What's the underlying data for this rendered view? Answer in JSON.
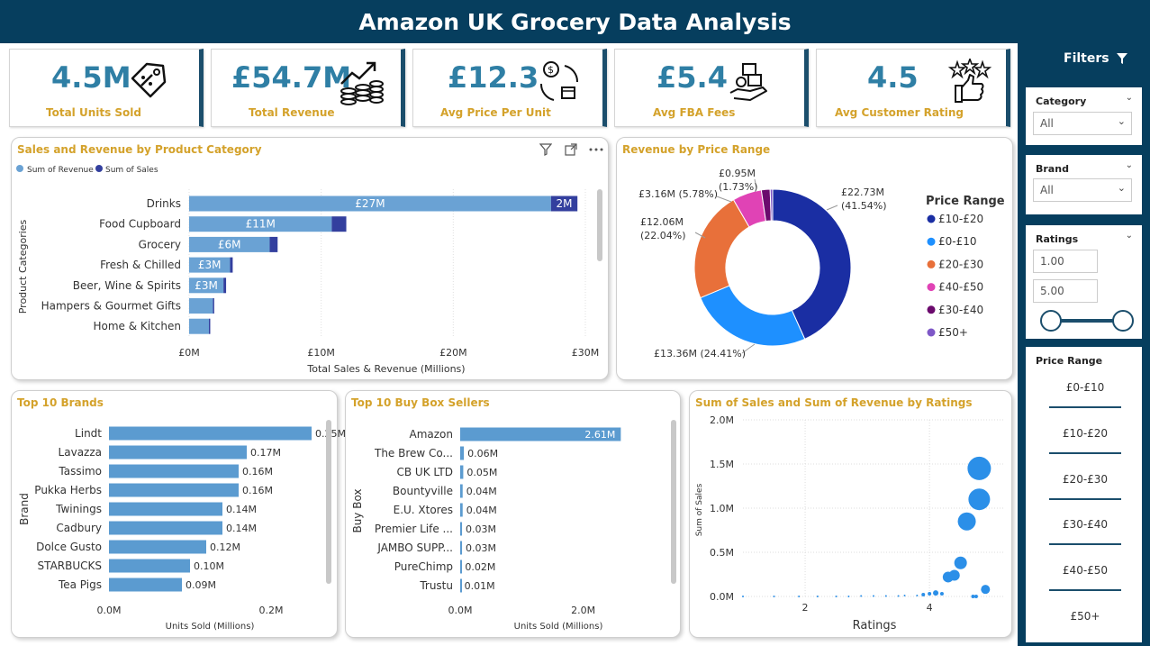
{
  "page_title": "Amazon UK Grocery Data Analysis",
  "kpis": [
    {
      "value": "4.5M",
      "label": "Total Units Sold",
      "icon": "price-tag-icon"
    },
    {
      "value": "£54.7M",
      "label": "Total Revenue",
      "icon": "revenue-growth-icon"
    },
    {
      "value": "£12.3",
      "label": "Avg Price Per Unit",
      "icon": "exchange-cycle-icon"
    },
    {
      "value": "£5.4",
      "label": "Avg FBA Fees",
      "icon": "hand-boxes-icon"
    },
    {
      "value": "4.5",
      "label": "Avg Customer Rating",
      "icon": "thumbs-up-stars-icon"
    }
  ],
  "colors": {
    "header": "#063e5e",
    "kpi_value": "#2f7fa5",
    "kpi_label": "#d4a22b",
    "revenue": "#6aa2d4",
    "sales": "#333f9e",
    "bar": "#5b9bd0",
    "scatter": "#2b8fe8"
  },
  "filters": {
    "title": "Filters",
    "category": {
      "label": "Category",
      "value": "All"
    },
    "brand": {
      "label": "Brand",
      "value": "All"
    },
    "ratings": {
      "label": "Ratings",
      "min": "1.00",
      "max": "5.00"
    },
    "price_range": {
      "label": "Price Range",
      "items": [
        "£0-£10",
        "£10-£20",
        "£20-£30",
        "£30-£40",
        "£40-£50",
        "£50+"
      ]
    }
  },
  "chart_data": [
    {
      "id": "category",
      "type": "bar",
      "title": "Sales and Revenue by Product Category",
      "legend": [
        "Sum of Revenue",
        "Sum of Sales"
      ],
      "categories": [
        "Drinks",
        "Food Cupboard",
        "Grocery",
        "Fresh & Chilled",
        "Beer, Wine & Spirits",
        "Hampers & Gourmet Gifts",
        "Home & Kitchen"
      ],
      "series": [
        {
          "name": "Sum of Revenue",
          "values": [
            27.4,
            10.8,
            6.1,
            3.1,
            2.6,
            1.8,
            1.5
          ],
          "labels": [
            "£27M",
            "£11M",
            "£6M",
            "£3M",
            "£3M",
            "",
            ""
          ]
        },
        {
          "name": "Sum of Sales",
          "values": [
            2.0,
            1.1,
            0.6,
            0.2,
            0.2,
            0.1,
            0.1
          ],
          "labels": [
            "2M",
            "",
            "",
            "",
            "",
            "",
            ""
          ]
        }
      ],
      "ticks": [
        "£0M",
        "£10M",
        "£20M",
        "£30M"
      ],
      "xlim": [
        0,
        30
      ],
      "xlabel": "Total Sales & Revenue (Millions)",
      "ylabel": "Product Categories"
    },
    {
      "id": "price",
      "type": "pie",
      "title": "Revenue by Price Range",
      "legend_title": "Price Range",
      "slices": [
        {
          "label": "£10-£20",
          "value": 22.73,
          "text": "£22.73M",
          "pct": "(41.54%)",
          "color": "#1a2ea3"
        },
        {
          "label": "£0-£10",
          "value": 13.36,
          "text": "£13.36M (24.41%)",
          "pct": "",
          "color": "#1e90ff"
        },
        {
          "label": "£20-£30",
          "value": 12.06,
          "text": "£12.06M",
          "pct": "(22.04%)",
          "color": "#e8703a"
        },
        {
          "label": "£40-£50",
          "value": 3.16,
          "text": "£3.16M (5.78%)",
          "pct": "",
          "color": "#e043b5"
        },
        {
          "label": "£30-£40",
          "value": 0.95,
          "text": "£0.95M",
          "pct": "(1.73%)",
          "color": "#6b0a6d"
        },
        {
          "label": "£50+",
          "value": 0.27,
          "text": "",
          "pct": "",
          "color": "#7e58c7"
        }
      ]
    },
    {
      "id": "brands",
      "type": "bar",
      "title": "Top 10 Brands",
      "categories": [
        "Lindt",
        "Lavazza",
        "Tassimo",
        "Pukka Herbs",
        "Twinings",
        "Cadbury",
        "Dolce Gusto",
        "STARBUCKS",
        "Tea Pigs"
      ],
      "values": [
        0.25,
        0.17,
        0.16,
        0.16,
        0.14,
        0.14,
        0.12,
        0.1,
        0.09
      ],
      "labels": [
        "0.25M",
        "0.17M",
        "0.16M",
        "0.16M",
        "0.14M",
        "0.14M",
        "0.12M",
        "0.10M",
        "0.09M"
      ],
      "ticks": [
        "0.0M",
        "0.2M"
      ],
      "xlim": [
        0,
        0.3
      ],
      "xlabel": "Units Sold (Millions)",
      "ylabel": "Brand"
    },
    {
      "id": "sellers",
      "type": "bar",
      "title": "Top 10 Buy Box Sellers",
      "categories": [
        "Amazon",
        "The Brew Co...",
        "CB UK LTD",
        "Bountyville",
        "E.U. Xtores",
        "Premier Life ...",
        "JAMBO SUPP...",
        "PureChimp",
        "Trustu"
      ],
      "values": [
        2.61,
        0.06,
        0.05,
        0.04,
        0.04,
        0.03,
        0.03,
        0.02,
        0.01
      ],
      "labels": [
        "2.61M",
        "0.06M",
        "0.05M",
        "0.04M",
        "0.04M",
        "0.03M",
        "0.03M",
        "0.02M",
        "0.01M"
      ],
      "ticks": [
        "0.0M",
        "2.0M"
      ],
      "xlim": [
        0,
        3.0
      ],
      "xlabel": "Units Sold (Millions)",
      "ylabel": "Buy Box"
    },
    {
      "id": "ratings",
      "type": "scatter",
      "title": "Sum of Sales and Sum of Revenue by Ratings",
      "x": [
        1.0,
        1.5,
        1.9,
        2.2,
        2.5,
        2.7,
        2.9,
        3.1,
        3.3,
        3.5,
        3.6,
        3.8,
        3.9,
        4.0,
        4.1,
        4.2,
        4.3,
        4.4,
        4.5,
        4.6,
        4.8,
        4.9,
        4.7,
        4.75,
        4.8
      ],
      "y": [
        0,
        0,
        0,
        0,
        0,
        0,
        0.005,
        0.005,
        0.005,
        0.005,
        0.01,
        0.01,
        0.02,
        0.03,
        0.04,
        0.03,
        0.22,
        0.24,
        0.38,
        0.85,
        1.45,
        0.08,
        0.0,
        0.0,
        1.1
      ],
      "r": [
        1,
        1,
        1,
        1,
        1,
        1,
        1,
        1,
        1,
        1,
        1,
        1,
        2,
        2,
        3,
        2,
        6,
        6,
        7,
        10,
        13,
        5,
        2,
        2,
        12
      ],
      "xticks": [
        2,
        4
      ],
      "yticks": [
        "0.0M",
        "0.5M",
        "1.0M",
        "1.5M",
        "2.0M"
      ],
      "xlim": [
        1,
        5.2
      ],
      "ylim": [
        0,
        2.0
      ],
      "xlabel": "Ratings",
      "ylabel": "Sum of Sales"
    }
  ]
}
